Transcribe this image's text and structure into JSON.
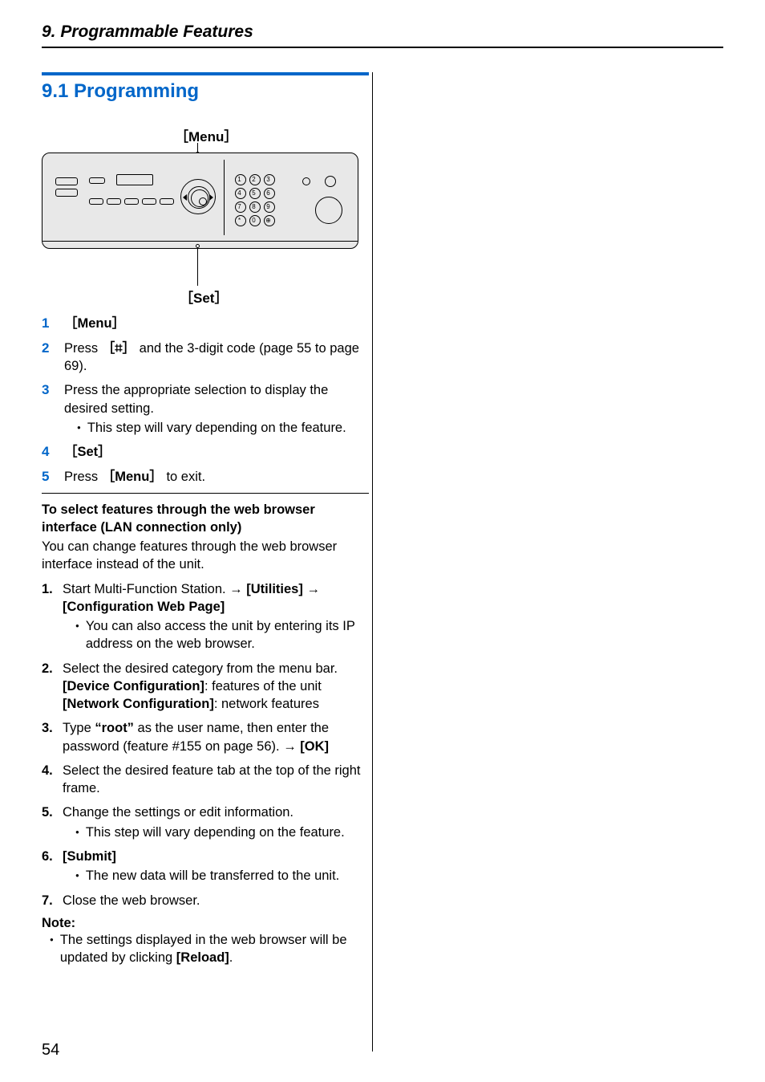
{
  "header": {
    "chapter": "9. Programmable Features"
  },
  "section": {
    "number_title": "9.1 Programming"
  },
  "figure": {
    "label_menu": "［Menu］",
    "label_set": "［Set］",
    "keys": [
      "1",
      "2",
      "3",
      "4",
      "5",
      "6",
      "7",
      "8",
      "9",
      "*",
      "0",
      "⊕"
    ]
  },
  "steps": [
    {
      "num": "1",
      "text": "［Menu］",
      "bold_all": true
    },
    {
      "num": "2",
      "parts": [
        {
          "t": "Press "
        },
        {
          "t": "［⌗］",
          "bold": true
        },
        {
          "t": " and the 3-digit code (page 55 to page 69)."
        }
      ]
    },
    {
      "num": "3",
      "parts": [
        {
          "t": "Press the appropriate selection to display the desired setting."
        }
      ],
      "bullets": [
        "This step will vary depending on the feature."
      ]
    },
    {
      "num": "4",
      "text": "［Set］",
      "bold_all": true
    },
    {
      "num": "5",
      "parts": [
        {
          "t": "Press "
        },
        {
          "t": "［Menu］",
          "bold": true
        },
        {
          "t": " to exit."
        }
      ]
    }
  ],
  "subsection": {
    "title": "To select features through the web browser interface (LAN connection only)",
    "intro": "You can change features through the web browser interface instead of the unit."
  },
  "nsteps": [
    {
      "num": "1.",
      "parts": [
        {
          "t": "Start Multi-Function Station. "
        },
        {
          "t": "→ ",
          "arrow": true
        },
        {
          "t": "[Utilities]",
          "bold": true
        },
        {
          "t": " "
        },
        {
          "t": "→ ",
          "arrow": true
        },
        {
          "t": "[Configuration Web Page]",
          "bold": true
        }
      ],
      "bullets": [
        "You can also access the unit by entering its IP address on the web browser."
      ]
    },
    {
      "num": "2.",
      "parts": [
        {
          "t": "Select the desired category from the menu bar."
        }
      ],
      "lines": [
        [
          {
            "t": "[Device Configuration]",
            "bold": true
          },
          {
            "t": ": features of the unit"
          }
        ],
        [
          {
            "t": "[Network Configuration]",
            "bold": true
          },
          {
            "t": ": network features"
          }
        ]
      ]
    },
    {
      "num": "3.",
      "parts": [
        {
          "t": "Type "
        },
        {
          "t": "“root”",
          "bold": true
        },
        {
          "t": " as the user name, then enter the password (feature #155 on page 56). "
        },
        {
          "t": "→ ",
          "arrow": true
        },
        {
          "t": "[OK]",
          "bold": true
        }
      ]
    },
    {
      "num": "4.",
      "parts": [
        {
          "t": "Select the desired feature tab at the top of the right frame."
        }
      ]
    },
    {
      "num": "5.",
      "parts": [
        {
          "t": "Change the settings or edit information."
        }
      ],
      "bullets": [
        "This step will vary depending on the feature."
      ]
    },
    {
      "num": "6.",
      "parts": [
        {
          "t": "[Submit]",
          "bold": true
        }
      ],
      "bullets": [
        "The new data will be transferred to the unit."
      ]
    },
    {
      "num": "7.",
      "parts": [
        {
          "t": "Close the web browser."
        }
      ]
    }
  ],
  "note": {
    "head": "Note:",
    "bullet_parts": [
      {
        "t": "The settings displayed in the web browser will be updated by clicking "
      },
      {
        "t": "[Reload]",
        "bold": true
      },
      {
        "t": "."
      }
    ]
  },
  "page_number": "54"
}
